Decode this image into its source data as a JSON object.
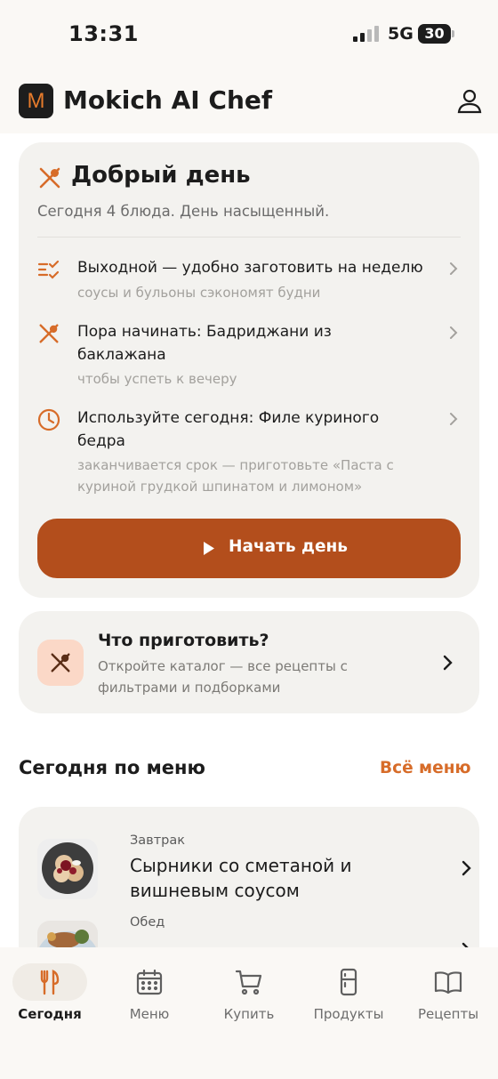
{
  "status_bar": {
    "time": "13:31",
    "network": "5G",
    "battery": "30"
  },
  "header": {
    "logo_letter": "M",
    "title": "Mokich AI Chef",
    "profile_icon": "person-icon"
  },
  "colors": {
    "accent": "#d76c29",
    "button": "#b34e1c",
    "card": "#f3f2ef"
  },
  "greeting": {
    "title": "Добрый день",
    "subtitle": "Сегодня 4 блюда. День насыщенный.",
    "tips": [
      {
        "icon": "list-check-icon",
        "title": "Выходной — удобно заготовить на неделю",
        "subtitle": "соусы и бульоны сэкономят будни"
      },
      {
        "icon": "utensils-icon",
        "title": "Пора начинать: Бадриджани из баклажана",
        "subtitle": "чтобы успеть к вечеру"
      },
      {
        "icon": "clock-icon",
        "title": "Используйте сегодня: Филе куриного бедра",
        "subtitle": "заканчивается срок — приготовьте «Паста с куриной грудкой шпинатом и лимоном»"
      }
    ],
    "start_button": "Начать день"
  },
  "cook": {
    "title": "Что приготовить?",
    "subtitle": "Откройте каталог — все рецепты с фильтрами и подборками"
  },
  "today_menu": {
    "title": "Сегодня по меню",
    "all_link": "Всё меню",
    "meals": [
      {
        "type": "Завтрак",
        "name": "Сырники со сметаной и вишневым соусом"
      },
      {
        "type": "Обед",
        "name": ""
      }
    ]
  },
  "tabs": [
    {
      "label": "Сегодня",
      "icon": "fork-knife-icon",
      "active": true
    },
    {
      "label": "Меню",
      "icon": "calendar-icon",
      "active": false
    },
    {
      "label": "Купить",
      "icon": "cart-icon",
      "active": false
    },
    {
      "label": "Продукты",
      "icon": "fridge-icon",
      "active": false
    },
    {
      "label": "Рецепты",
      "icon": "book-icon",
      "active": false
    }
  ]
}
